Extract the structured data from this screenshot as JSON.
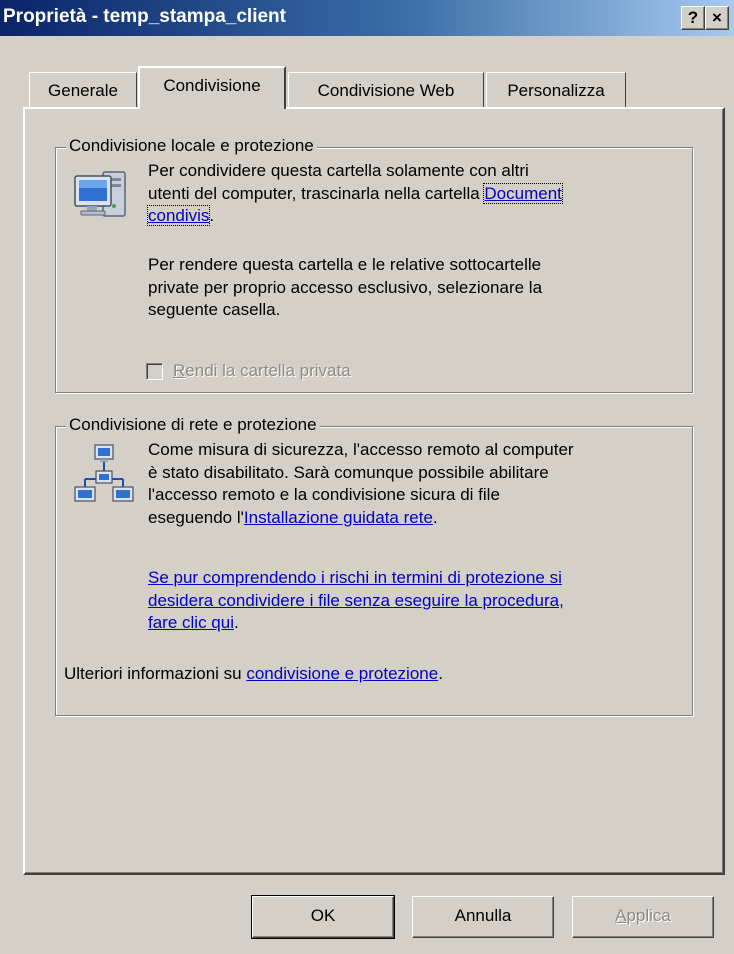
{
  "window": {
    "title": "Proprietà - temp_stampa_client",
    "help_glyph": "?",
    "close_glyph": "×"
  },
  "tabs": [
    {
      "label": "Generale",
      "active": false
    },
    {
      "label": "Condivisione",
      "active": true
    },
    {
      "label": "Condivisione Web",
      "active": false
    },
    {
      "label": "Personalizza",
      "active": false
    }
  ],
  "local_group": {
    "legend": "Condivisione locale e protezione",
    "icon": "computer-icon",
    "para1_line1": "Per condividere questa cartella solamente con altri",
    "para1_line2_prefix": "utenti del computer, trascinarla nella cartella ",
    "para1_link_part1": "Document",
    "para1_link_part2": "condivis",
    "para1_line3_suffix": ".",
    "para2_line1": "Per rendere questa cartella e le relative sottocartelle",
    "para2_line2": "private per proprio accesso esclusivo, selezionare la",
    "para2_line3": "seguente casella.",
    "checkbox_mnemonic": "R",
    "checkbox_label_rest": "endi la cartella privata",
    "checkbox_checked": false
  },
  "network_group": {
    "legend": "Condivisione di rete e protezione",
    "icon": "network-icon",
    "para1_line1": "Come misura di sicurezza, l'accesso remoto al computer",
    "para1_line2": "è stato disabilitato. Sarà comunque possibile abilitare",
    "para1_line3": "l'accesso remoto e la condivisione sicura di file",
    "para1_line4_prefix": "eseguendo l'",
    "para1_link": "Installazione guidata rete",
    "para1_line4_suffix": ".",
    "link2_line1": "Se pur comprendendo i rischi in termini di protezione si",
    "link2_line2": "desidera condividere i file senza eseguire la procedura,",
    "link2_line3": "fare clic qui",
    "link2_suffix": ".",
    "more_prefix": "Ulteriori informazioni su ",
    "more_link": "condivisione e protezione",
    "more_suffix": "."
  },
  "buttons": {
    "ok": "OK",
    "cancel": "Annulla",
    "apply_mnemonic": "A",
    "apply_rest": "pplica"
  },
  "colors": {
    "link": "#0000c8",
    "titlebar_start": "#0a246a",
    "titlebar_end": "#a6caf0",
    "face": "#d4d0c8"
  }
}
